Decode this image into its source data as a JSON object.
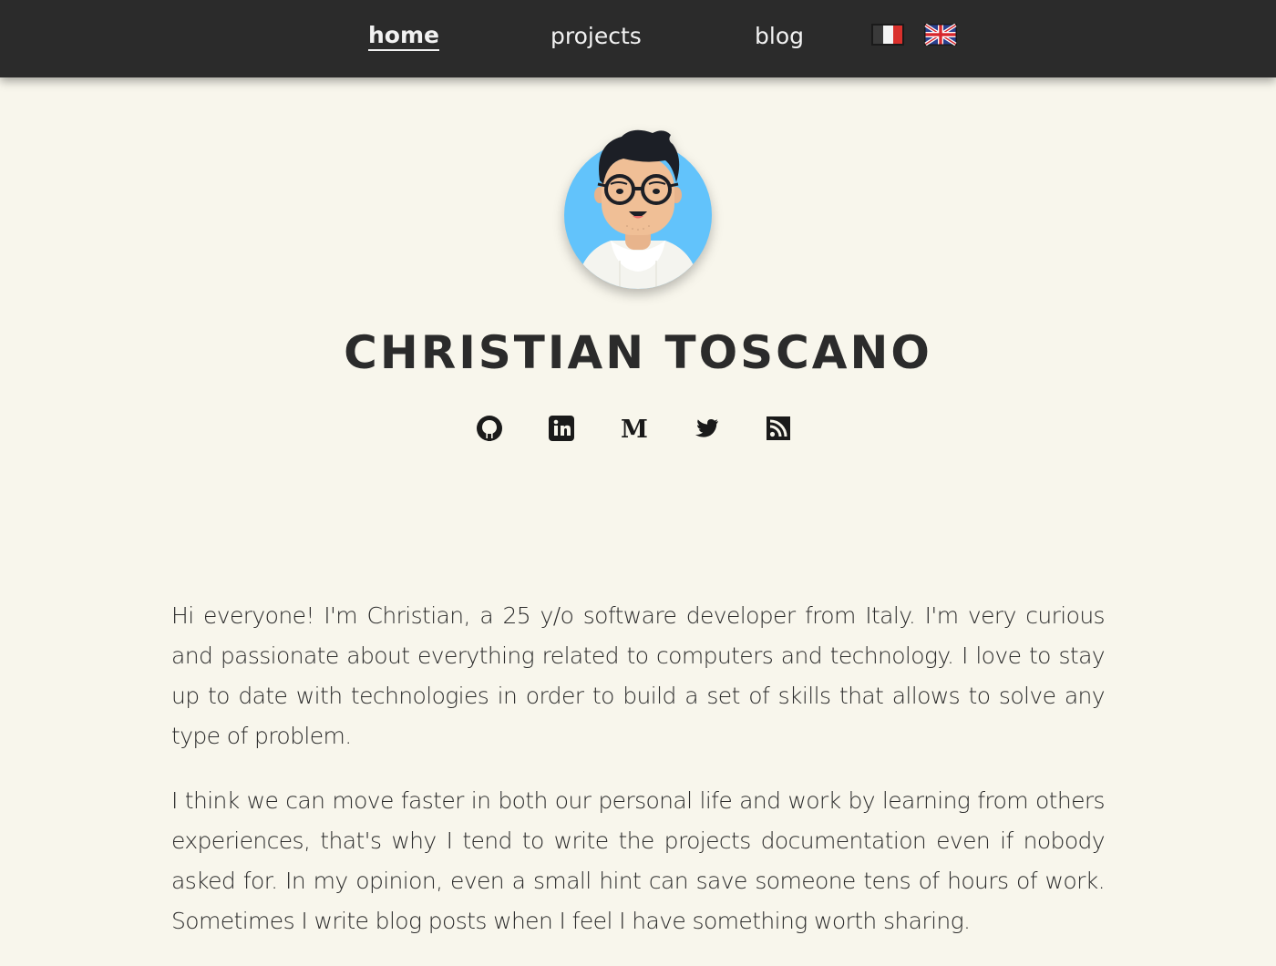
{
  "nav": {
    "home": "home",
    "projects": "projects",
    "blog": "blog",
    "flags": [
      "italian-flag",
      "uk-flag"
    ]
  },
  "profile": {
    "name": "CHRISTIAN TOSCANO",
    "social_icons": [
      "github-icon",
      "linkedin-icon",
      "medium-icon",
      "twitter-icon",
      "rss-icon"
    ]
  },
  "about": {
    "paragraph_1": "Hi everyone! I'm Christian, a 25 y/o software developer from Italy. I'm very curious and passionate about everything related to computers and technology. I love to stay up to date with technologies in order to build a set of skills that allows to solve any type of problem.",
    "paragraph_2": "I think we can move faster in both our personal life and work by learning from others experiences, that's why I tend to write the projects documentation even if nobody asked for. In my opinion, even a small hint can save someone tens of hours of work. Sometimes I write blog posts when I feel I have something worth sharing."
  },
  "colors": {
    "navbar": "#2b2b2b",
    "background": "#f8f6ec",
    "text": "#2b2b2b",
    "avatar_bg": "#62c3fb"
  }
}
